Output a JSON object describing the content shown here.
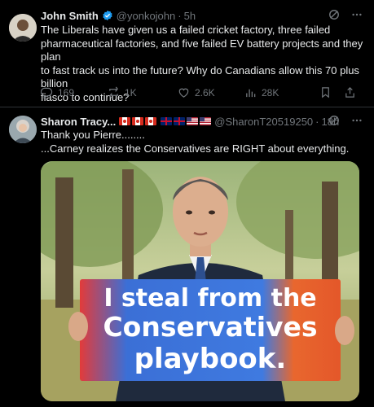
{
  "tweet1": {
    "name": "John Smith",
    "handle": "@yonkojohn",
    "time": "5h",
    "text_lines": [
      "The Liberals have given us a failed cricket factory, three failed",
      "pharmaceutical factories, and five failed EV battery projects and they plan",
      "to fast track us into the future?  Why do Canadians allow this 70 plus billion",
      "fiasco to continue?"
    ],
    "replies": "169",
    "reposts": "1K",
    "likes": "2.6K",
    "views": "28K"
  },
  "tweet2": {
    "name": "Sharon Tracy...",
    "handle": "@SharonT20519250",
    "time": "18h",
    "flags": [
      "ca",
      "ca",
      "ca",
      "uk",
      "uk",
      "us",
      "us"
    ],
    "text_lines": [
      "Thank you Pierre........",
      "...Carney realizes the Conservatives are RIGHT about everything."
    ],
    "sign_lines": [
      "I steal from the",
      "Conservatives",
      "playbook."
    ]
  },
  "colors": {
    "verified_blue": "#1d9bf0",
    "muted": "#71767b",
    "divider": "#2f3336"
  },
  "icons": [
    "verified-badge-icon",
    "grok-icon",
    "more-icon",
    "reply-icon",
    "repost-icon",
    "like-icon",
    "views-icon",
    "bookmark-icon",
    "share-icon"
  ]
}
